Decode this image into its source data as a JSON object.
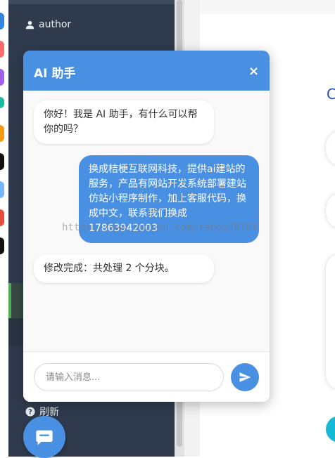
{
  "sidebar": {
    "author_label": "author",
    "refresh_label": "刷新"
  },
  "chat": {
    "title": "AI 助手",
    "close_symbol": "×",
    "messages": [
      {
        "role": "bot",
        "text": "你好！我是 AI 助手，有什么可以帮你的吗？"
      },
      {
        "role": "user",
        "text": "换成桔梗互联网科技，提供ai建站的服务，产品有网站开发系统部署建站仿站小程序制作，加上客服代码，换成中文，联系我们换成17863942003"
      },
      {
        "role": "bot",
        "text": "修改完成：共处理 2 个分块。"
      }
    ],
    "input_placeholder": "请输入消息..."
  },
  "main": {
    "partial_letter": "C"
  },
  "watermark": "https://www.huzhan.com/ishop29781",
  "colors": {
    "accent": "#4a90e2",
    "sidebar_bg": "#2f3b4d",
    "active_indicator": "#4caf50"
  },
  "icons": {
    "author": "user-icon",
    "refresh": "question-circle-icon",
    "send": "paper-plane-icon",
    "chat_fab": "chat-bubble-icon"
  }
}
